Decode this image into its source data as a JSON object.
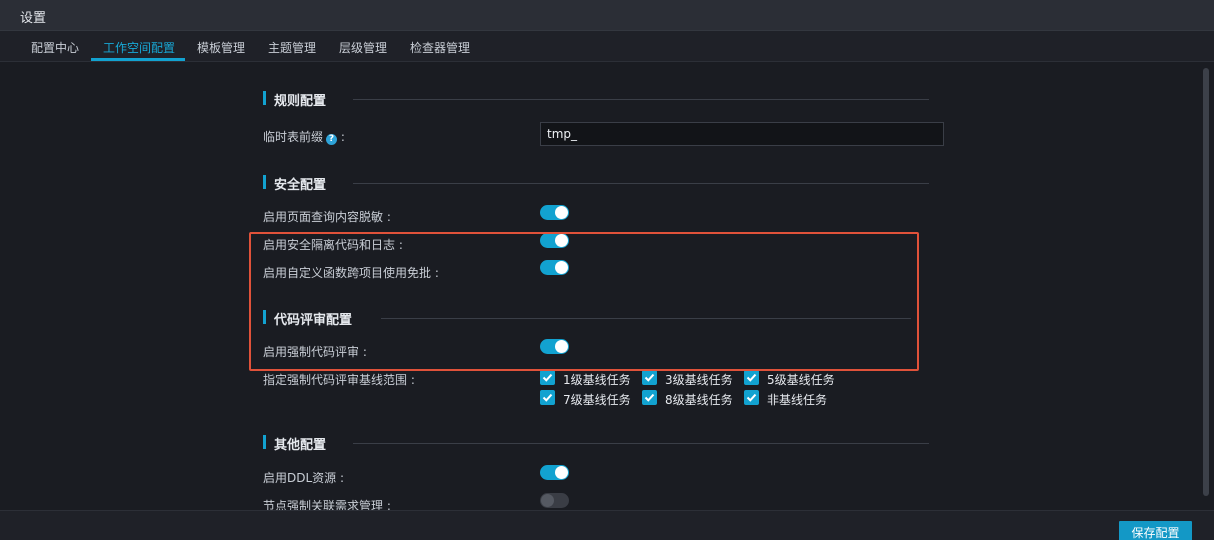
{
  "window": {
    "title": "设置"
  },
  "tabs": [
    {
      "label": "配置中心"
    },
    {
      "label": "工作空间配置",
      "active": true
    },
    {
      "label": "模板管理"
    },
    {
      "label": "主题管理"
    },
    {
      "label": "层级管理"
    },
    {
      "label": "检查器管理"
    }
  ],
  "sections": {
    "rules": {
      "title": "规则配置",
      "temp_prefix_label": "临时表前缀",
      "temp_prefix_suffix": ":",
      "temp_prefix_value": "tmp_",
      "help_icon": "question-circle-icon"
    },
    "security": {
      "title": "安全配置",
      "items": [
        {
          "label": "启用页面查询内容脱敏 :",
          "on": true
        },
        {
          "label": "启用安全隔离代码和日志 :",
          "on": true
        },
        {
          "label": "启用自定义函数跨项目使用免批 :",
          "on": true
        }
      ]
    },
    "code_review": {
      "title": "代码评审配置",
      "enforce_label": "启用强制代码评审 :",
      "enforce_on": true,
      "scope_label": "指定强制代码评审基线范围 :",
      "scope_options": [
        {
          "label": "1级基线任务",
          "checked": true
        },
        {
          "label": "3级基线任务",
          "checked": true
        },
        {
          "label": "5级基线任务",
          "checked": true
        },
        {
          "label": "7级基线任务",
          "checked": true
        },
        {
          "label": "8级基线任务",
          "checked": true
        },
        {
          "label": "非基线任务",
          "checked": true
        }
      ]
    },
    "other": {
      "title": "其他配置",
      "items": [
        {
          "label": "启用DDL资源 :",
          "on": true
        },
        {
          "label": "节点强制关联需求管理 :",
          "on": false
        }
      ]
    }
  },
  "footer": {
    "save_label": "保存配置"
  },
  "colors": {
    "accent": "#12a2d0",
    "highlight": "#e0523a",
    "background": "#1a1c22"
  }
}
